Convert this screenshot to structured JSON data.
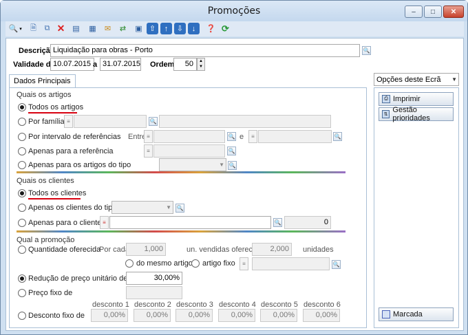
{
  "window": {
    "title": "Promoções",
    "min": "–",
    "max": "□",
    "close": "✕"
  },
  "toolbar": {
    "icons": [
      "search-icon",
      "new-document-icon",
      "copy-icon",
      "delete-icon",
      "properties-icon",
      "grid-icon",
      "email-icon",
      "refresh-icon",
      "preview-icon",
      "move-up-icon",
      "first-icon",
      "move-down-icon",
      "last-icon",
      "help-icon",
      "sync-icon"
    ]
  },
  "header": {
    "descricao_label": "Descrição",
    "descricao_value": "Liquidação para obras - Porto",
    "validade_label": "Validade de",
    "validade_from": "10.07.2015",
    "a_label": "a",
    "validade_to": "31.07.2015",
    "ordem_label": "Ordem",
    "ordem_value": "50"
  },
  "tab": {
    "label": "Dados Principais"
  },
  "artigos": {
    "title": "Quais os artigos",
    "todos": "Todos os artigos",
    "familia": "Por família",
    "intervalo": "Por intervalo de referências",
    "entre": "Entre",
    "e": "e",
    "referencia": "Apenas para a referência",
    "tipo": "Apenas para os artigos do tipo"
  },
  "clientes": {
    "title": "Quais os clientes",
    "todos": "Todos os clientes",
    "tipo": "Apenas os clientes do tipo",
    "cliente": "Apenas para o cliente",
    "cliente_count": "0"
  },
  "promocao": {
    "title": "Qual a promoção",
    "quantidade": "Quantidade oferecida",
    "por_cada": "Por cada",
    "por_cada_value": "1,000",
    "un_vendidas": "un. vendidas oferece",
    "oferece_value": "2,000",
    "unidades": "unidades",
    "mesmo_artigo": "do mesmo artigo",
    "artigo_fixo": "artigo fixo",
    "reducao": "Redução de preço unitário de",
    "reducao_value": "30,00%",
    "preco_fixo": "Preço fixo de",
    "desconto_fixo": "Desconto fixo de",
    "descontos": [
      {
        "label": "desconto 1",
        "value": "0,00%"
      },
      {
        "label": "desconto 2",
        "value": "0,00%"
      },
      {
        "label": "desconto 3",
        "value": "0,00%"
      },
      {
        "label": "desconto 4",
        "value": "0,00%"
      },
      {
        "label": "desconto 5",
        "value": "0,00%"
      },
      {
        "label": "desconto 6",
        "value": "0,00%"
      }
    ]
  },
  "side": {
    "options_label": "Opções deste Ecrã",
    "imprimir": "Imprimir",
    "gestao": "Gestão prioridades",
    "marcada": "Marcada"
  }
}
